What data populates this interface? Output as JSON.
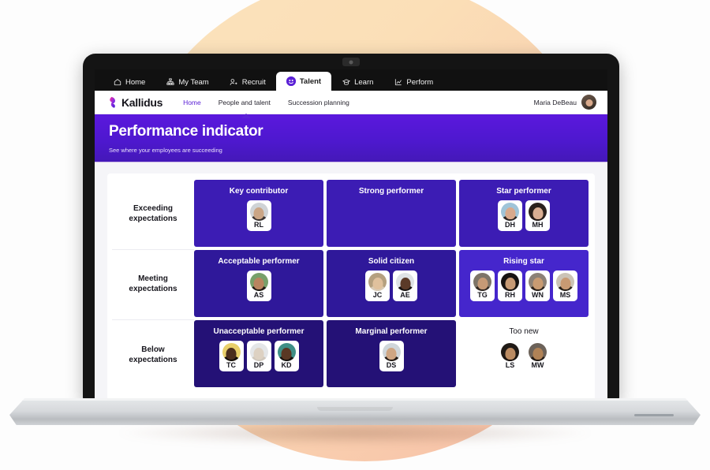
{
  "os_tabs": [
    {
      "label": "Home",
      "icon": "home-icon",
      "active": false
    },
    {
      "label": "My Team",
      "icon": "org-chart-icon",
      "active": false
    },
    {
      "label": "Recruit",
      "icon": "recruit-icon",
      "active": false
    },
    {
      "label": "Talent",
      "icon": "talent-icon",
      "active": true
    },
    {
      "label": "Learn",
      "icon": "graduation-cap-icon",
      "active": false
    },
    {
      "label": "Perform",
      "icon": "chart-icon",
      "active": false
    }
  ],
  "appbar": {
    "brand": "Kallidus",
    "nav": [
      {
        "label": "Home",
        "active": true
      },
      {
        "label": "People and talent",
        "active": false
      },
      {
        "label": "Succession planning",
        "active": false
      }
    ],
    "user_name": "Maria DeBeau"
  },
  "hero": {
    "title": "Performance indicator",
    "subtitle": "See where your employees are succeeding"
  },
  "matrix": {
    "row_labels": [
      "Exceeding\nexpectations",
      "Meeting\nexpectations",
      "Below\nexpectations"
    ],
    "rows": [
      {
        "cells": [
          {
            "title": "Key contributor",
            "bg": "#3c1cb4",
            "style": "dark",
            "people": [
              {
                "initials": "RL",
                "skin": "#caa585",
                "hair": "#3a3330",
                "bg": "#cfd3d6"
              }
            ]
          },
          {
            "title": "Strong performer",
            "bg": "#3c1cb4",
            "style": "dark",
            "people": []
          },
          {
            "title": "Star performer",
            "bg": "#3c1cb4",
            "style": "dark",
            "people": [
              {
                "initials": "DH",
                "skin": "#d8a98c",
                "hair": "#2b2320",
                "bg": "#9fc4d8"
              },
              {
                "initials": "MH",
                "skin": "#d9ae92",
                "hair": "#241a16",
                "bg": "#2a211c"
              }
            ]
          }
        ]
      },
      {
        "cells": [
          {
            "title": "Acceptable performer",
            "bg": "#2f189a",
            "style": "dark",
            "people": [
              {
                "initials": "AS",
                "skin": "#b9845f",
                "hair": "#1f1713",
                "bg": "#77a06a"
              }
            ]
          },
          {
            "title": "Solid citizen",
            "bg": "#2f189a",
            "style": "dark",
            "people": [
              {
                "initials": "JC",
                "skin": "#e0c19d",
                "hair": "#d9cbb6",
                "bg": "#b5a07f"
              },
              {
                "initials": "AE",
                "skin": "#5b3a28",
                "hair": "#181210",
                "bg": "#dfe3e6"
              }
            ]
          },
          {
            "title": "Rising star",
            "bg": "#4526cc",
            "style": "dark",
            "people": [
              {
                "initials": "TG",
                "skin": "#c69a76",
                "hair": "#2e2622",
                "bg": "#7d7468"
              },
              {
                "initials": "RH",
                "skin": "#c79a74",
                "hair": "#1a1512",
                "bg": "#161210"
              },
              {
                "initials": "WN",
                "skin": "#c89b72",
                "hair": "#2a211a",
                "bg": "#8c8176"
              },
              {
                "initials": "MS",
                "skin": "#c89a73",
                "hair": "#272019",
                "bg": "#cbc3b6"
              }
            ]
          }
        ]
      },
      {
        "cells": [
          {
            "title": "Unacceptable performer",
            "bg": "#241176",
            "style": "dark",
            "people": [
              {
                "initials": "TC",
                "skin": "#4a2d1d",
                "hair": "#120d0a",
                "bg": "#e8cf6a"
              },
              {
                "initials": "DP",
                "skin": "#ddd1c2",
                "hair": "#cfc7bc",
                "bg": "#e4e6e8"
              },
              {
                "initials": "KD",
                "skin": "#5a3824",
                "hair": "#17100c",
                "bg": "#3f8f86"
              }
            ]
          },
          {
            "title": "Marginal performer",
            "bg": "#241176",
            "style": "dark",
            "people": [
              {
                "initials": "DS",
                "skin": "#cfa683",
                "hair": "#241b15",
                "bg": "#cfd6da"
              }
            ]
          },
          {
            "title": "Too new",
            "bg": "#ffffff",
            "style": "light",
            "people": [
              {
                "initials": "LS",
                "skin": "#bb8b62",
                "hair": "#1c1410",
                "bg": "#201a16"
              },
              {
                "initials": "MW",
                "skin": "#b08256",
                "hair": "#221a14",
                "bg": "#6c6259"
              }
            ]
          }
        ]
      }
    ]
  },
  "colors": {
    "brand_purple": "#5b21d6",
    "hero_gradient_start": "#5b18dd",
    "hero_gradient_end": "#4418b8",
    "page_bg": "#f5f5f8"
  }
}
